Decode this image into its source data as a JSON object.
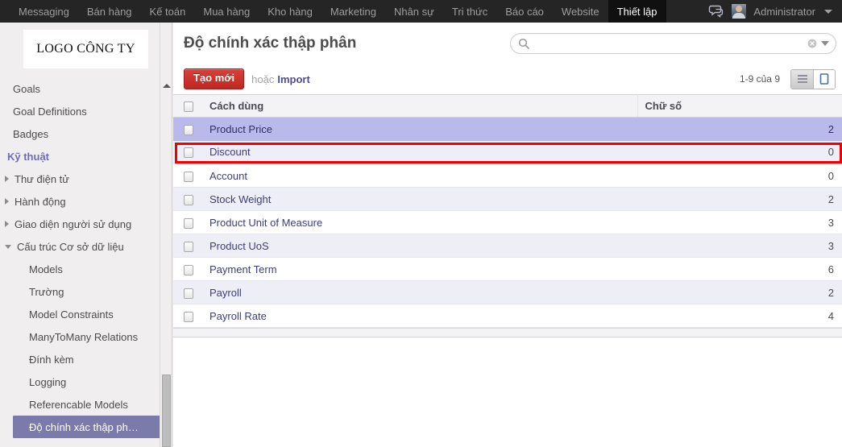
{
  "topbar": {
    "menu": [
      {
        "label": "Messaging",
        "active": false
      },
      {
        "label": "Bán hàng",
        "active": false
      },
      {
        "label": "Kế toán",
        "active": false
      },
      {
        "label": "Mua hàng",
        "active": false
      },
      {
        "label": "Kho hàng",
        "active": false
      },
      {
        "label": "Marketing",
        "active": false
      },
      {
        "label": "Nhân sự",
        "active": false
      },
      {
        "label": "Tri thức",
        "active": false
      },
      {
        "label": "Báo cáo",
        "active": false
      },
      {
        "label": "Website",
        "active": false
      },
      {
        "label": "Thiết lập",
        "active": true
      }
    ],
    "chat_icon": "chat-bubble-icon",
    "user_name": "Administrator",
    "user_caret": "caret-down-icon"
  },
  "sidebar": {
    "logo_text": "LOGO CÔNG TY",
    "items": [
      {
        "label": "Goals",
        "level": "l0",
        "type": "link"
      },
      {
        "label": "Goal Definitions",
        "level": "l0",
        "type": "link"
      },
      {
        "label": "Badges",
        "level": "l0",
        "type": "link"
      },
      {
        "label": "Kỹ thuật",
        "level": "section",
        "type": "section"
      },
      {
        "label": "Thư điện tử",
        "level": "l1",
        "type": "tree-closed"
      },
      {
        "label": "Hành động",
        "level": "l1",
        "type": "tree-closed"
      },
      {
        "label": "Giao diện người sử dụng",
        "level": "l1",
        "type": "tree-closed"
      },
      {
        "label": "Cấu trúc Cơ sở dữ liệu",
        "level": "l1",
        "type": "tree-open"
      },
      {
        "label": "Models",
        "level": "l2",
        "type": "link"
      },
      {
        "label": "Trường",
        "level": "l2",
        "type": "link"
      },
      {
        "label": "Model Constraints",
        "level": "l2",
        "type": "link"
      },
      {
        "label": "ManyToMany Relations",
        "level": "l2",
        "type": "link"
      },
      {
        "label": "Đính kèm",
        "level": "l2",
        "type": "link"
      },
      {
        "label": "Logging",
        "level": "l2",
        "type": "link"
      },
      {
        "label": "Referencable Models",
        "level": "l2",
        "type": "link"
      },
      {
        "label": "Độ chính xác thập ph…",
        "level": "l2",
        "type": "selected"
      }
    ],
    "scroll_up_icon": "scroll-up-arrow-icon"
  },
  "content": {
    "page_title": "Độ chính xác thập phân",
    "search": {
      "value": "",
      "placeholder": "",
      "icon": "search-icon",
      "clear_icon": "clear-circle-icon",
      "caret_icon": "caret-down-icon"
    },
    "toolbar": {
      "create_label": "Tạo mới",
      "or_label": "hoặc",
      "import_label": "Import",
      "pager_label": "1-9 của 9",
      "view_list_icon": "list-view-icon",
      "view_form_icon": "form-view-icon"
    },
    "table": {
      "headers": [
        "Cách dùng",
        "Chữ số"
      ],
      "rows": [
        {
          "name": "Product Price",
          "digits": "2",
          "selected": true
        },
        {
          "name": "Discount",
          "digits": "0",
          "selected": false
        },
        {
          "name": "Account",
          "digits": "0",
          "selected": false
        },
        {
          "name": "Stock Weight",
          "digits": "2",
          "selected": false
        },
        {
          "name": "Product Unit of Measure",
          "digits": "3",
          "selected": false
        },
        {
          "name": "Product UoS",
          "digits": "3",
          "selected": false
        },
        {
          "name": "Payment Term",
          "digits": "6",
          "selected": false
        },
        {
          "name": "Payroll",
          "digits": "2",
          "selected": false
        },
        {
          "name": "Payroll Rate",
          "digits": "4",
          "selected": false
        }
      ]
    }
  },
  "colors": {
    "topbar_bg": "#252525",
    "accent_red": "#bf2722",
    "selected_row": "#b9b9ec",
    "selected_nav": "#7b7bab",
    "highlight_border": "#f00000",
    "link_blue": "#4c4c8f",
    "section_purple": "#6d6db5"
  }
}
